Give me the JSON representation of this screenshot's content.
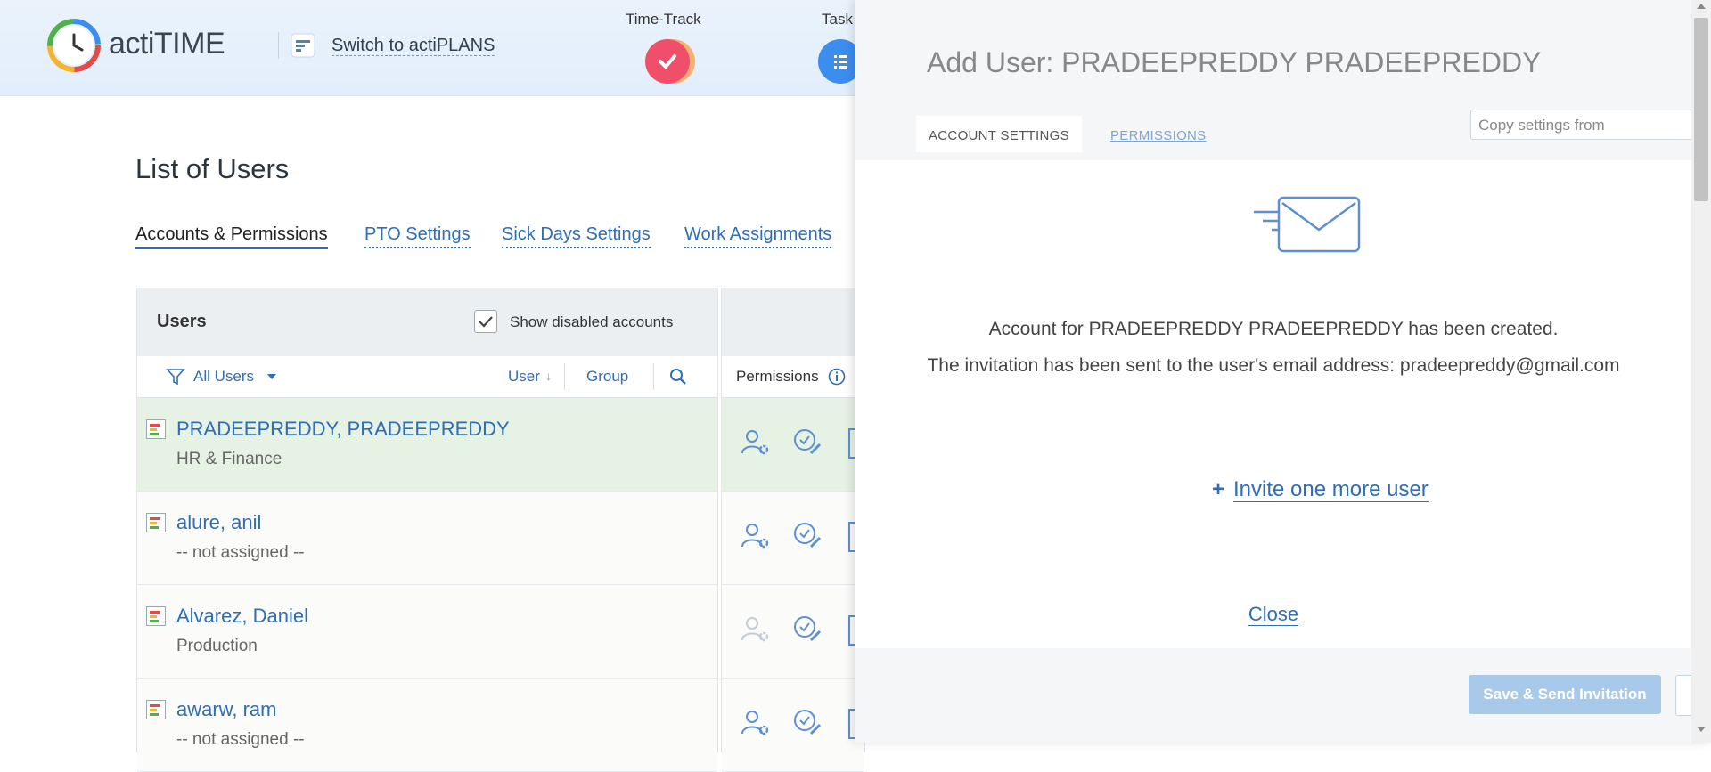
{
  "header": {
    "logo_text": "actiTIME",
    "switch_label": "Switch to actiPLANS",
    "nav": [
      {
        "label": "Time-Track",
        "icon": "checkmark-icon",
        "color": "#ef4f68"
      },
      {
        "label": "Task",
        "icon": "task-list-icon",
        "color": "#3b8ef0"
      }
    ]
  },
  "page": {
    "title": "List of Users",
    "subtabs": [
      "Accounts & Permissions",
      "PTO Settings",
      "Sick Days Settings",
      "Work Assignments"
    ],
    "active_subtab": "Accounts & Permissions"
  },
  "users_panel": {
    "title": "Users",
    "show_disabled_label": "Show disabled accounts",
    "show_disabled_checked": true,
    "filter_label": "All Users",
    "sort_user": "User",
    "sort_group": "Group",
    "permissions_label": "Permissions",
    "rows": [
      {
        "name": "PRADEEPREDDY, PRADEEPREDDY",
        "group": "HR & Finance",
        "selected": true
      },
      {
        "name": "alure, anil",
        "group": "-- not assigned --",
        "selected": false
      },
      {
        "name": "Alvarez, Daniel",
        "group": "Production",
        "selected": false
      },
      {
        "name": "awarw, ram",
        "group": "-- not assigned --",
        "selected": false
      }
    ]
  },
  "sheet": {
    "title": "Add User: PRADEEPREDDY PRADEEPREDDY",
    "tabs": {
      "account": "ACCOUNT SETTINGS",
      "permissions": "PERMISSIONS"
    },
    "copy_placeholder": "Copy settings from",
    "message_created": "Account for PRADEEPREDDY PRADEEPREDDY has been created.",
    "message_sent": "The invitation has been sent to the user's email address: pradeepreddy@gmail.com",
    "invite_more": "Invite one more user",
    "close": "Close",
    "save_button": "Save & Send Invitation"
  }
}
